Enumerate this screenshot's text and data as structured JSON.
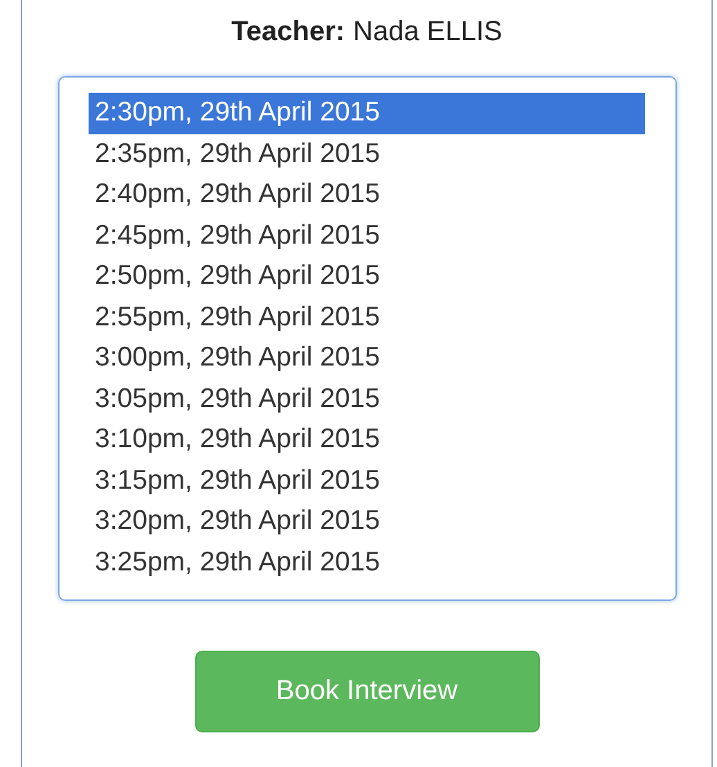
{
  "teacher": {
    "label": "Teacher:",
    "name": "Nada ELLIS"
  },
  "slots": [
    {
      "label": "2:30pm, 29th April 2015",
      "selected": true
    },
    {
      "label": "2:35pm, 29th April 2015",
      "selected": false
    },
    {
      "label": "2:40pm, 29th April 2015",
      "selected": false
    },
    {
      "label": "2:45pm, 29th April 2015",
      "selected": false
    },
    {
      "label": "2:50pm, 29th April 2015",
      "selected": false
    },
    {
      "label": "2:55pm, 29th April 2015",
      "selected": false
    },
    {
      "label": "3:00pm, 29th April 2015",
      "selected": false
    },
    {
      "label": "3:05pm, 29th April 2015",
      "selected": false
    },
    {
      "label": "3:10pm, 29th April 2015",
      "selected": false
    },
    {
      "label": "3:15pm, 29th April 2015",
      "selected": false
    },
    {
      "label": "3:20pm, 29th April 2015",
      "selected": false
    },
    {
      "label": "3:25pm, 29th April 2015",
      "selected": false
    }
  ],
  "button": "Book Interview"
}
